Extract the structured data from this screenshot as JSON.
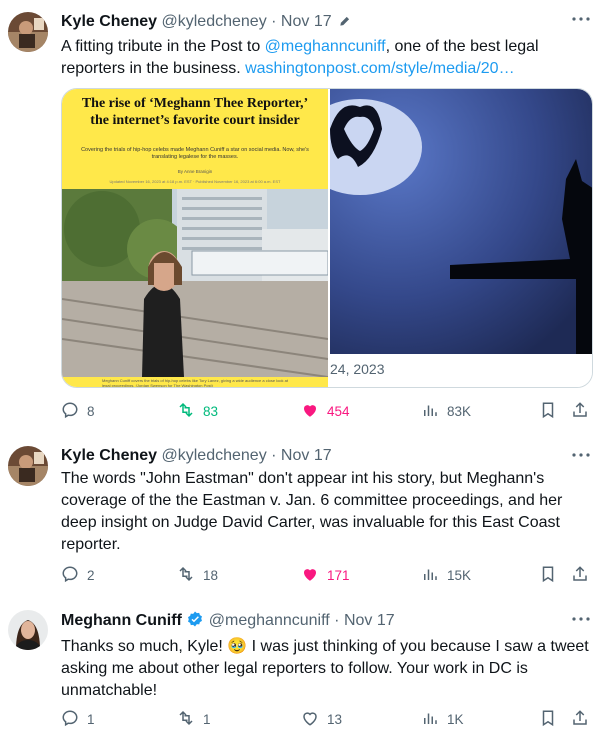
{
  "tweets": [
    {
      "name": "Kyle Cheney",
      "handle": "@kyledcheney",
      "dot": "·",
      "time": "Nov 17",
      "edited_icon": "pencil-icon",
      "text_before": "A fitting tribute in the Post to ",
      "mention": "@meghanncuniff",
      "text_after": ", one of the best legal reporters in the business. ",
      "url": "washingtonpost.com/style/media/20…",
      "article": {
        "title": "The rise of ‘Meghann Thee Reporter,’ the internet’s favorite court insider",
        "subtitle": "Covering the trials of hip-hop celebs made Meghann Cuniff a star on social media. Now, she’s translating legalese for the masses.",
        "byline": "By Anne Branigin",
        "dates": "Updated November 16, 2023 at 4:18 p.m. EST · Published November 16, 2023 at 6:00 a.m. EST",
        "caption": "Meghann Cuniff covers the trials of hip-hop celebs like Tory Lanez, giving a wide audience a close look at legal proceedings. (Jordan Swenson for The Washington Post)"
      },
      "card_date": "24, 2023",
      "stats": {
        "replies": "8",
        "retweets": "83",
        "likes": "454",
        "views": "83K"
      }
    },
    {
      "name": "Kyle Cheney",
      "handle": "@kyledcheney",
      "dot": "·",
      "time": "Nov 17",
      "text": "The words \"John Eastman\" don't appear int his story, but Meghann's coverage of the the Eastman v. Jan. 6 committee proceedings, and her deep insight on Judge David Carter, was invaluable for this East Coast reporter.",
      "stats": {
        "replies": "2",
        "retweets": "18",
        "likes": "171",
        "views": "15K"
      }
    },
    {
      "name": "Meghann Cuniff",
      "verified_icon": "verified-badge-icon",
      "handle": "@meghanncuniff",
      "dot": "·",
      "time": "Nov 17",
      "text_before": "Thanks so much, Kyle! ",
      "emoji": "🥹",
      "text_after": " I was just thinking of you because I saw a tweet asking me about other legal reporters to follow. Your work in DC is unmatchable!",
      "stats": {
        "replies": "1",
        "retweets": "1",
        "likes": "13",
        "views": "1K"
      }
    }
  ],
  "colors": {
    "link": "#1d9bf0",
    "retweet_active": "#00ba7c",
    "like_active": "#f91880",
    "secondary": "#536471"
  }
}
